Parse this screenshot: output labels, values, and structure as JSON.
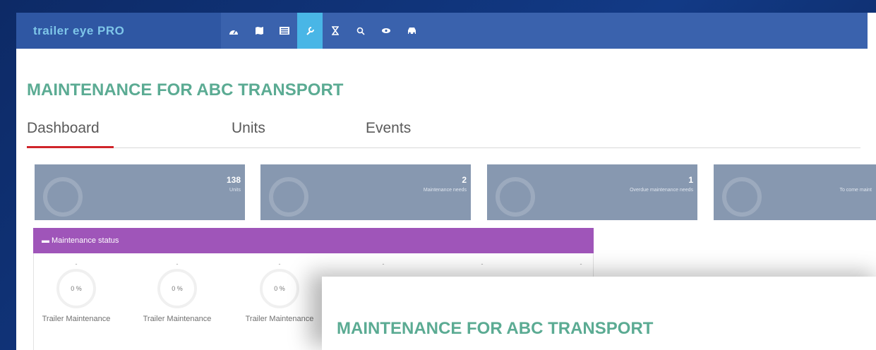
{
  "app": {
    "logo_text": "trailer eye PRO"
  },
  "nav": {
    "icons": [
      "dashboard-icon",
      "map-icon",
      "list-icon",
      "wrench-icon",
      "hourglass-icon",
      "search-icon",
      "eye-icon",
      "truck-icon"
    ],
    "active_index": 3
  },
  "page": {
    "title": "MAINTENANCE FOR ABC TRANSPORT"
  },
  "tabs": [
    {
      "label": "Dashboard",
      "active": true
    },
    {
      "label": "Units",
      "active": false
    },
    {
      "label": "Events",
      "active": false
    }
  ],
  "cards": [
    {
      "value": "138",
      "label": "Units"
    },
    {
      "value": "2",
      "label": "Maintenance needs"
    },
    {
      "value": "1",
      "label": "Overdue maintenance needs"
    },
    {
      "value": "",
      "label": "To come maint"
    }
  ],
  "maintenance_status": {
    "header": "Maintenance status",
    "items": [
      {
        "dash": "-",
        "percent": "0 %",
        "name": "Trailer Maintenance"
      },
      {
        "dash": "-",
        "percent": "0 %",
        "name": "Trailer Maintenance"
      },
      {
        "dash": "-",
        "percent": "0 %",
        "name": "Trailer Maintenance"
      },
      {
        "dash": "-",
        "percent": "",
        "name": ""
      },
      {
        "dash": "-",
        "percent": "",
        "name": ""
      },
      {
        "dash": "-",
        "percent": "",
        "name": ""
      }
    ]
  },
  "overlay": {
    "title": "MAINTENANCE FOR ABC TRANSPORT"
  },
  "colors": {
    "topbar": "#3a62ad",
    "active_nav": "#49b6e6",
    "title_green": "#5bab93",
    "tab_underline": "#d0242a",
    "card_bg": "#8798b0",
    "status_header": "#9f55b9"
  }
}
